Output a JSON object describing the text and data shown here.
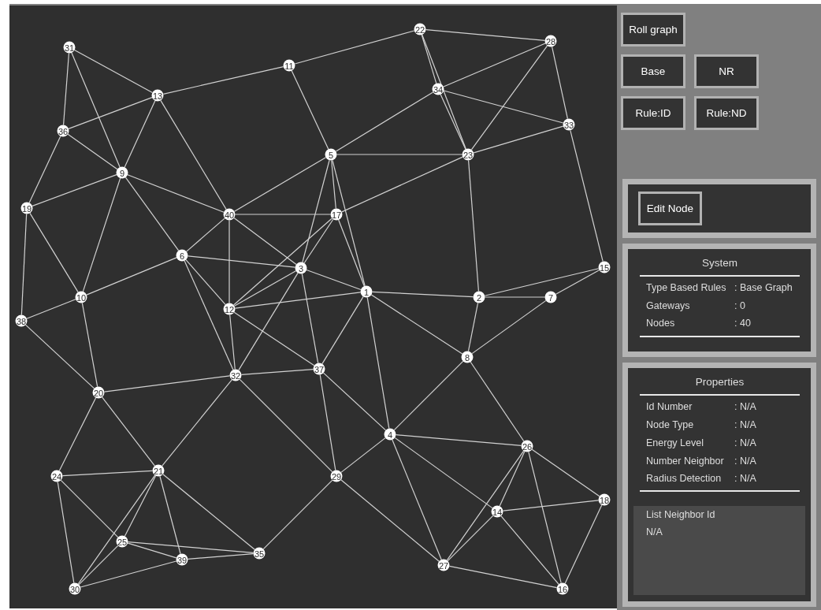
{
  "graph": {
    "nodes": [
      "1",
      "2",
      "3",
      "4",
      "5",
      "6",
      "7",
      "8",
      "9",
      "10",
      "11",
      "12",
      "13",
      "14",
      "15",
      "16",
      "17",
      "18",
      "19",
      "20",
      "21",
      "22",
      "23",
      "24",
      "25",
      "26",
      "27",
      "28",
      "29",
      "30",
      "31",
      "32",
      "33",
      "34",
      "35",
      "36",
      "37",
      "38",
      "39",
      "40"
    ]
  },
  "controls": {
    "button_rows": [
      [
        "Roll graph"
      ],
      [
        "Base",
        "NR"
      ],
      [
        "Rule:ID",
        "Rule:ND"
      ]
    ]
  },
  "edit_panel": {
    "button": "Edit Node"
  },
  "system": {
    "title": "System",
    "rows": [
      {
        "label": "Type Based Rules",
        "value": ": Base Graph"
      },
      {
        "label": "Gateways",
        "value": ": 0"
      },
      {
        "label": "Nodes",
        "value": ": 40"
      }
    ]
  },
  "properties": {
    "title": "Properties",
    "rows": [
      {
        "label": "Id Number",
        "value": ": N/A"
      },
      {
        "label": "Node Type",
        "value": ": N/A"
      },
      {
        "label": "Energy Level",
        "value": ": N/A"
      },
      {
        "label": "Number Neighbor",
        "value": ": N/A"
      },
      {
        "label": "Radius Detection",
        "value": ": N/A"
      }
    ],
    "neighbor_list": {
      "title": "List Neighbor Id",
      "value": "N/A"
    }
  }
}
